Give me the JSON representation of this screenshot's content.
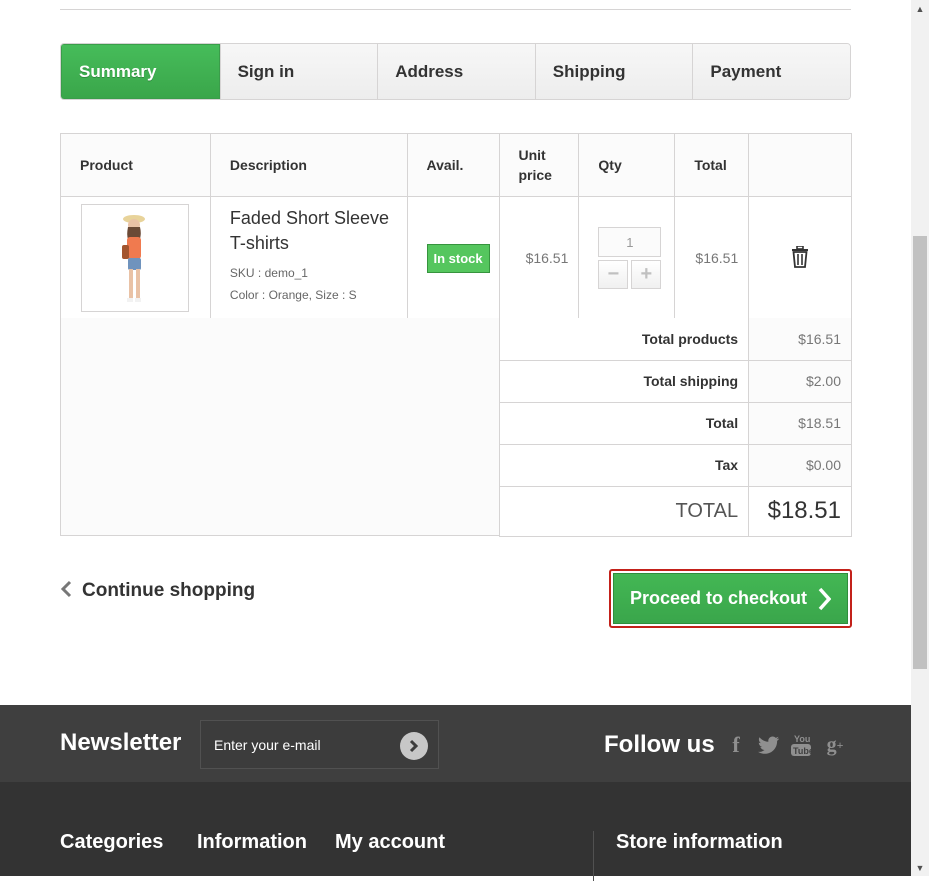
{
  "steps": [
    {
      "label": "Summary",
      "active": true
    },
    {
      "label": "Sign in"
    },
    {
      "label": "Address"
    },
    {
      "label": "Shipping"
    },
    {
      "label": "Payment"
    }
  ],
  "cart": {
    "headers": {
      "product": "Product",
      "description": "Description",
      "avail": "Avail.",
      "unit_price": "Unit price",
      "qty": "Qty",
      "total": "Total"
    },
    "item": {
      "name": "Faded Short Sleeve T-shirts",
      "sku": "SKU : demo_1",
      "attributes": "Color : Orange, Size : S",
      "availability": "In stock",
      "unit_price": "$16.51",
      "qty": "1",
      "total": "$16.51"
    }
  },
  "totals": [
    {
      "label": "Total products",
      "value": "$16.51"
    },
    {
      "label": "Total shipping",
      "value": "$2.00"
    },
    {
      "label": "Total",
      "value": "$18.51"
    },
    {
      "label": "Tax",
      "value": "$0.00"
    },
    {
      "label": "TOTAL",
      "value": "$18.51"
    }
  ],
  "actions": {
    "continue_label": "Continue shopping",
    "checkout_label": "Proceed to checkout"
  },
  "footer": {
    "newsletter_title": "Newsletter",
    "newsletter_placeholder": "Enter your e-mail",
    "follow_title": "Follow us",
    "social": [
      "facebook-icon",
      "twitter-icon",
      "youtube-icon",
      "google-plus-icon"
    ],
    "columns": [
      "Categories",
      "Information",
      "My account",
      "Store information"
    ]
  },
  "colors": {
    "accent_green": "#46bc5a",
    "checkout_border": "#c3211a",
    "footer_bar": "#3f3f3f",
    "footer_dark": "#333333"
  }
}
